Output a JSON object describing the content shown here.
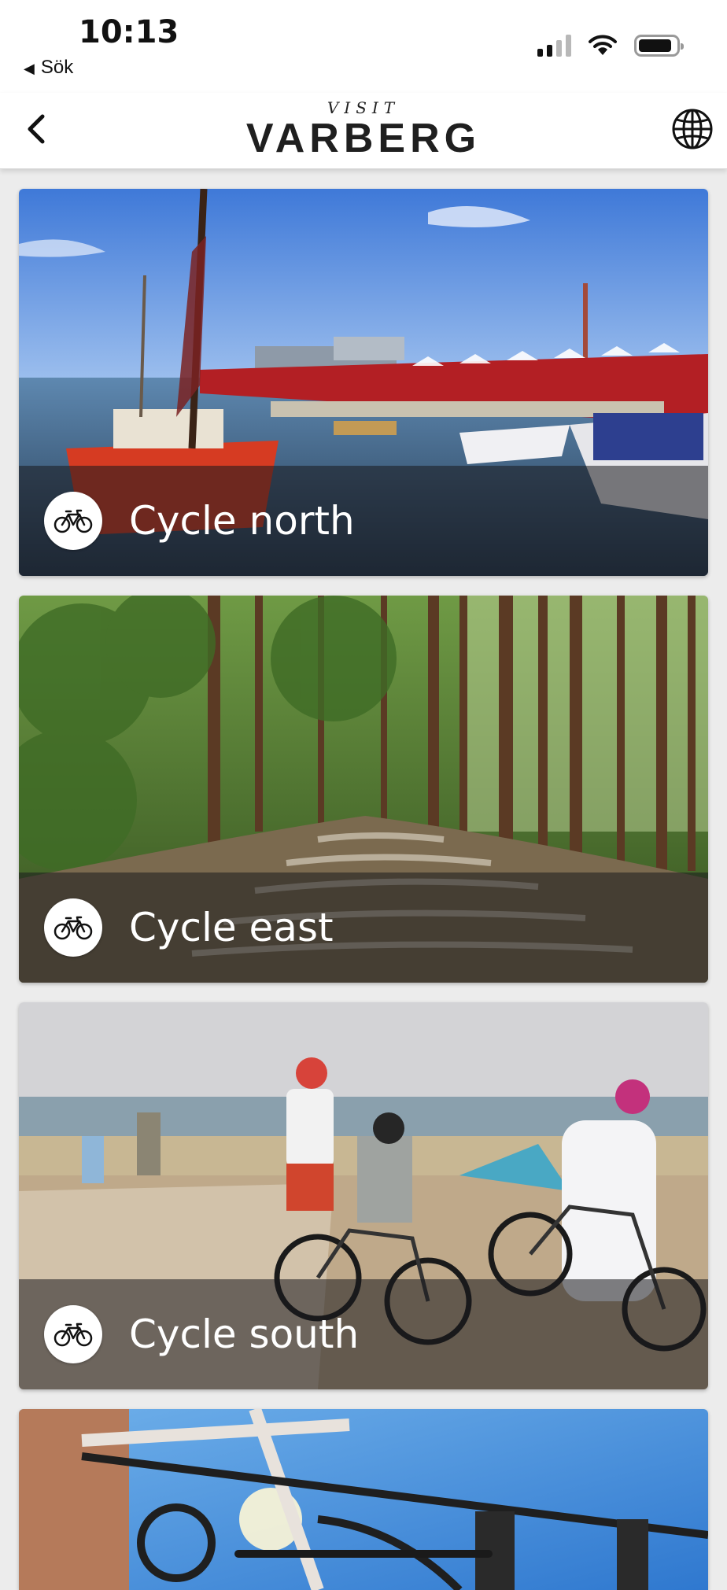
{
  "status_bar": {
    "time": "10:13",
    "back_app": "Sök"
  },
  "header": {
    "logo_small": "VISIT",
    "logo_big": "VARBERG"
  },
  "cards": [
    {
      "title": "Cycle north",
      "icon": "bicycle-icon"
    },
    {
      "title": "Cycle east",
      "icon": "bicycle-icon"
    },
    {
      "title": "Cycle south",
      "icon": "bicycle-icon"
    }
  ],
  "colors": {
    "overlay": "#19191e",
    "badge": "#ffffff",
    "header_bg": "#ffffff",
    "page_bg": "#ececec"
  }
}
